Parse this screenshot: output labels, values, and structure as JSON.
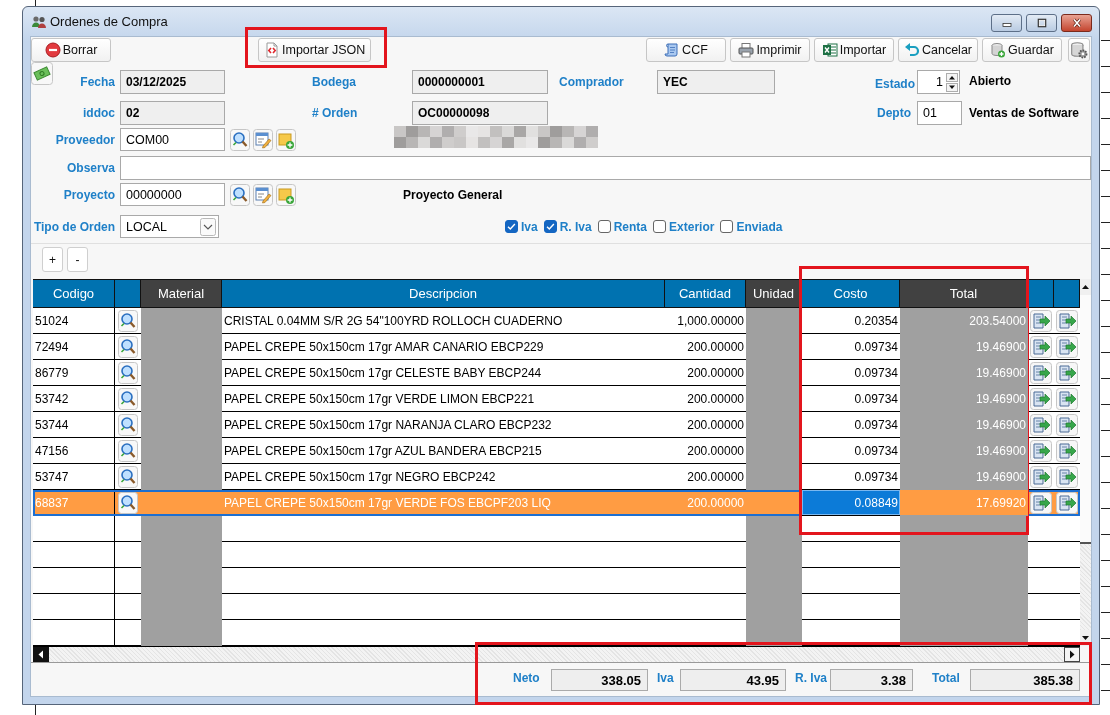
{
  "window": {
    "title": "Ordenes de Compra"
  },
  "toolbar": {
    "left": [
      {
        "kind": "delete",
        "label": "Borrar",
        "highlighted": false
      },
      {
        "kind": "import_json",
        "label": "Importar JSON",
        "highlighted": true
      }
    ],
    "right": [
      {
        "kind": "ccf",
        "label": "CCF",
        "highlighted": false
      },
      {
        "kind": "print",
        "label": "Imprimir",
        "highlighted": false
      },
      {
        "kind": "excel",
        "label": "Importar",
        "highlighted": false
      },
      {
        "kind": "undo",
        "label": "Cancelar",
        "highlighted": false
      },
      {
        "kind": "save",
        "label": "Guardar",
        "highlighted": false
      },
      {
        "kind": "settings",
        "highlighted": false
      }
    ]
  },
  "form": {
    "fecha": {
      "label": "Fecha",
      "value": "03/12/2025",
      "readonly": true
    },
    "bodega": {
      "label": "Bodega",
      "value": "0000000001",
      "readonly": true
    },
    "comprador": {
      "label": "Comprador",
      "value": "YEC",
      "readonly": true
    },
    "estado": {
      "label": "Estado",
      "value": "1",
      "status": "Abierto"
    },
    "iddoc": {
      "label": "iddoc",
      "value": "02",
      "readonly": true
    },
    "orden": {
      "label": "# Orden",
      "value": "OC00000098",
      "readonly": true
    },
    "depto": {
      "label": "Depto",
      "value": "01",
      "readonly": false,
      "name": "Ventas de Software"
    },
    "proveedor": {
      "label": "Proveedor",
      "value": "COM00",
      "readonly": false,
      "actions": [
        {
          "kind": "search"
        },
        {
          "kind": "edit"
        },
        {
          "kind": "add"
        }
      ],
      "name_redacted": true
    },
    "observa": {
      "label": "Observa",
      "readonly": false
    },
    "proyecto": {
      "label": "Proyecto",
      "value": "00000000",
      "readonly": false,
      "actions": [
        {
          "kind": "search"
        },
        {
          "kind": "edit"
        },
        {
          "kind": "add"
        }
      ],
      "name": "Proyecto General"
    },
    "tipo_orden": {
      "label": "Tipo de Orden",
      "value": "LOCAL"
    },
    "options": [
      {
        "label": "Iva",
        "checked": true
      },
      {
        "label": "R. Iva",
        "checked": true
      },
      {
        "label": "Renta",
        "checked": false
      },
      {
        "label": "Exterior",
        "checked": false
      },
      {
        "label": "Enviada",
        "checked": false
      }
    ]
  },
  "row_buttons": [
    "+",
    "-"
  ],
  "table": {
    "columns": [
      {
        "kind": "codigo",
        "label": "Codigo",
        "locked": false,
        "highlighted": false
      },
      {
        "kind": "lookup",
        "locked": false,
        "highlighted": false
      },
      {
        "kind": "material",
        "label": "Material",
        "locked": true,
        "highlighted": false
      },
      {
        "kind": "descripcion",
        "label": "Descripcion",
        "locked": false,
        "highlighted": false
      },
      {
        "kind": "cantidad",
        "label": "Cantidad",
        "locked": false,
        "highlighted": false
      },
      {
        "kind": "unidad",
        "label": "Unidad",
        "locked": true,
        "highlighted": false
      },
      {
        "kind": "costo",
        "label": "Costo",
        "locked": false,
        "highlighted": true
      },
      {
        "kind": "total",
        "label": "Total",
        "locked": true,
        "highlighted": true
      },
      {
        "kind": "action",
        "locked": false,
        "highlighted": false
      },
      {
        "kind": "action",
        "locked": false,
        "highlighted": false
      }
    ],
    "rows": [
      {
        "codigo": "51024",
        "descripcion": "CRISTAL 0.04MM S/R 2G 54\"100YRD ROLLOCH CUADERNO",
        "cantidad": "1,000.00000",
        "costo": "0.20354",
        "total": "203.54000",
        "selected": false,
        "costo_editing": false
      },
      {
        "codigo": "72494",
        "descripcion": "PAPEL CREPE 50x150cm 17gr AMAR CANARIO EBCP229",
        "cantidad": "200.00000",
        "costo": "0.09734",
        "total": "19.46900",
        "selected": false,
        "costo_editing": false
      },
      {
        "codigo": "86779",
        "descripcion": "PAPEL CREPE 50x150cm 17gr CELESTE BABY EBCP244",
        "cantidad": "200.00000",
        "costo": "0.09734",
        "total": "19.46900",
        "selected": false,
        "costo_editing": false
      },
      {
        "codigo": "53742",
        "descripcion": "PAPEL CREPE 50x150cm 17gr VERDE LIMON EBCP221",
        "cantidad": "200.00000",
        "costo": "0.09734",
        "total": "19.46900",
        "selected": false,
        "costo_editing": false
      },
      {
        "codigo": "53744",
        "descripcion": "PAPEL CREPE 50x150cm 17gr NARANJA CLARO EBCP232",
        "cantidad": "200.00000",
        "costo": "0.09734",
        "total": "19.46900",
        "selected": false,
        "costo_editing": false
      },
      {
        "codigo": "47156",
        "descripcion": "PAPEL CREPE 50x150cm 17gr AZUL BANDERA EBCP215",
        "cantidad": "200.00000",
        "costo": "0.09734",
        "total": "19.46900",
        "selected": false,
        "costo_editing": false
      },
      {
        "codigo": "53747",
        "descripcion": "PAPEL CREPE 50x150cm 17gr NEGRO EBCP242",
        "cantidad": "200.00000",
        "costo": "0.09734",
        "total": "19.46900",
        "selected": false,
        "costo_editing": false
      },
      {
        "codigo": "68837",
        "descripcion": "PAPEL CREPE 50x150cm 17gr VERDE FOS EBCPF203 LIQ",
        "cantidad": "200.00000",
        "costo": "0.08849",
        "total": "17.69920",
        "selected": true,
        "costo_editing": true
      }
    ]
  },
  "totals": {
    "highlighted": true,
    "items": [
      {
        "label": "Neto",
        "value": "338.05"
      },
      {
        "label": "Iva",
        "value": "43.95"
      },
      {
        "label": "R. Iva",
        "value": "3.38"
      },
      {
        "label": "Total",
        "value": "385.38"
      }
    ]
  }
}
